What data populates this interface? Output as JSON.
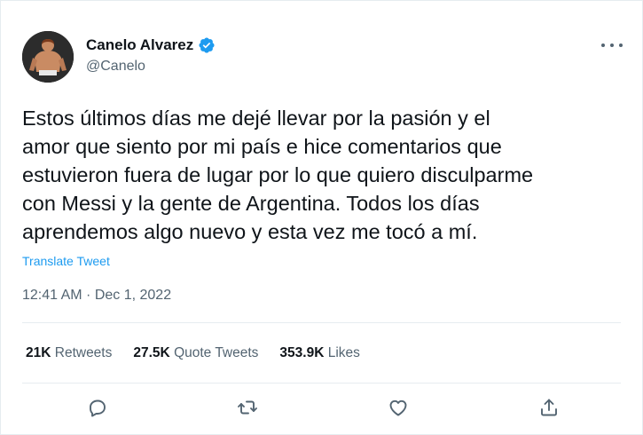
{
  "author": {
    "display_name": "Canelo Alvarez",
    "handle": "@Canelo",
    "verified_icon": "verified-badge-icon"
  },
  "more_icon": "more-options-icon",
  "tweet": {
    "lines": [
      "Estos últimos días me dejé llevar por la pasión y el",
      "amor que siento por mi país e hice comentarios que",
      "estuvieron fuera de lugar por lo que quiero disculparme",
      "con Messi y la gente de Argentina. Todos los días",
      "aprendemos algo nuevo y esta vez me tocó a mí."
    ],
    "translate_label": "Translate Tweet",
    "timestamp": "12:41 AM · Dec 1, 2022"
  },
  "stats": {
    "retweets": {
      "count": "21K",
      "label": "Retweets"
    },
    "quote_tweets": {
      "count": "27.5K",
      "label": "Quote Tweets"
    },
    "likes": {
      "count": "353.9K",
      "label": "Likes"
    }
  },
  "actions": [
    "reply-icon",
    "retweet-icon",
    "like-icon",
    "share-icon"
  ],
  "colors": {
    "accent": "#1d9bf0",
    "text": "#0f1419",
    "secondary": "#536471",
    "divider": "#e6ecf0"
  }
}
